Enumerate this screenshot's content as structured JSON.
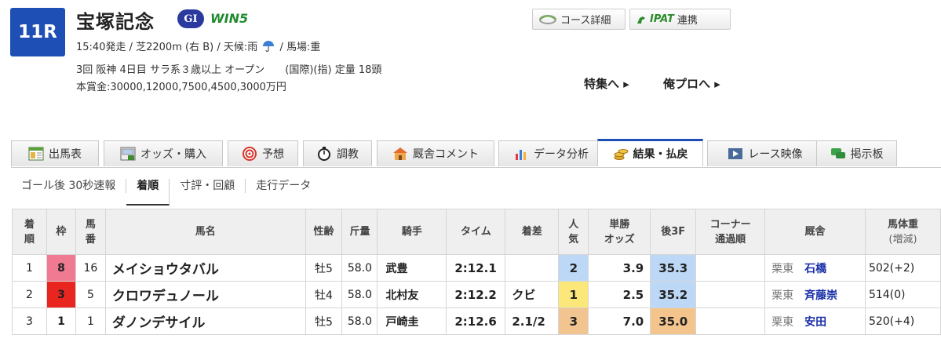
{
  "race": {
    "number": "11R",
    "title": "宝塚記念",
    "grade": "GI",
    "win5": "WIN5",
    "info_line1_a": "15:40発走 / 芝2200m (右 B) / 天候:雨",
    "info_line1_b": "/ 馬場:重",
    "info_line2": "3回 阪神 4日目 サラ系３歳以上 オープン　　(国際)(指) 定量 18頭",
    "info_line3": "本賞金:30000,12000,7500,4500,3000万円"
  },
  "buttons": {
    "course": "コース詳細",
    "ipat_logo": "IPAT",
    "ipat": "連携",
    "feature": "特集へ ▸",
    "yopro": "俺プロへ ▸"
  },
  "tabs": [
    {
      "label": "出馬表",
      "icon": "table-icon"
    },
    {
      "label": "オッズ・購入",
      "icon": "odds-icon"
    },
    {
      "label": "予想",
      "icon": "target-icon"
    },
    {
      "label": "調教",
      "icon": "stopwatch-icon"
    },
    {
      "label": "厩舎コメント",
      "icon": "stable-icon"
    },
    {
      "label": "データ分析",
      "icon": "bar-chart-icon"
    },
    {
      "label": "結果・払戻",
      "icon": "coins-icon",
      "active": true
    },
    {
      "label": "レース映像",
      "icon": "video-icon"
    },
    {
      "label": "掲示板",
      "icon": "chat-icon"
    }
  ],
  "subnav": [
    "ゴール後 30秒速報",
    "着順",
    "寸評・回顧",
    "走行データ"
  ],
  "table": {
    "headers": {
      "rank_a": "着",
      "rank_b": "順",
      "waku": "枠",
      "umaban_a": "馬",
      "umaban_b": "番",
      "name": "馬名",
      "sexage": "性齢",
      "kinryo": "斤量",
      "jockey": "騎手",
      "time": "タイム",
      "margin": "着差",
      "pop_a": "人",
      "pop_b": "気",
      "odds_a": "単勝",
      "odds_b": "オッズ",
      "f3": "後3F",
      "corner_a": "コーナー",
      "corner_b": "通過順",
      "trainer": "厩舎",
      "weight_a": "馬体重",
      "weight_b": "(増減)"
    },
    "rows": [
      {
        "rank": "1",
        "waku": "8",
        "umaban": "16",
        "name": "メイショウタバル",
        "sexage": "牡5",
        "kinryo": "58.0",
        "jockey": "武豊",
        "time": "2:12.1",
        "margin": "",
        "pop": "2",
        "odds": "3.9",
        "f3": "35.3",
        "corner": "",
        "trainer_loc": "栗東",
        "trainer": "石橋",
        "weight": "502(+2)"
      },
      {
        "rank": "2",
        "waku": "3",
        "umaban": "5",
        "name": "クロワデュノール",
        "sexage": "牡4",
        "kinryo": "58.0",
        "jockey": "北村友",
        "time": "2:12.2",
        "margin": "クビ",
        "pop": "1",
        "odds": "2.5",
        "f3": "35.2",
        "corner": "",
        "trainer_loc": "栗東",
        "trainer": "斉藤崇",
        "weight": "514(0)"
      },
      {
        "rank": "3",
        "waku": "1",
        "umaban": "1",
        "name": "ダノンデサイル",
        "sexage": "牡5",
        "kinryo": "58.0",
        "jockey": "戸崎圭",
        "time": "2:12.6",
        "margin": "2.1/2",
        "pop": "3",
        "odds": "7.0",
        "f3": "35.0",
        "corner": "",
        "trainer_loc": "栗東",
        "trainer": "安田",
        "weight": "520(+4)"
      }
    ]
  },
  "colors": {
    "accent": "#1e4fb5",
    "waku_8": "#f07a92",
    "waku_3": "#e8251f",
    "odds": "#e0241c",
    "horse_link": "#1a2fa8"
  }
}
